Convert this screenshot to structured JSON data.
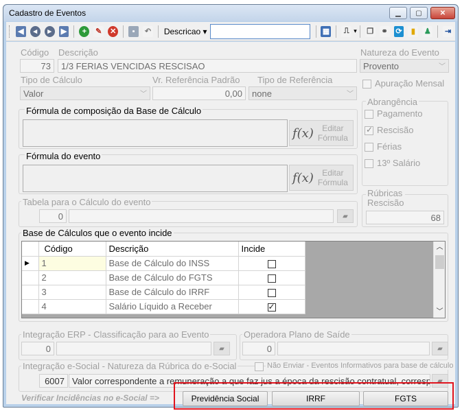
{
  "window": {
    "title": "Cadastro de Eventos",
    "minimize": "▁",
    "maximize": "▢",
    "close": "✕"
  },
  "toolbar": {
    "search_mode_label": "Descricao ▾",
    "search_value": ""
  },
  "form": {
    "codigo_label": "Código",
    "codigo_value": "73",
    "descricao_label": "Descrição",
    "descricao_value": "1/3 FERIAS VENCIDAS RESCISAO",
    "natureza_label": "Natureza do Evento",
    "natureza_value": "Provento",
    "tipo_calculo_label": "Tipo de Cálculo",
    "tipo_calculo_value": "Valor",
    "vr_referencia_label": "Vr. Referência Padrão",
    "vr_referencia_value": "0,00",
    "tipo_referencia_label": "Tipo de Referência",
    "tipo_referencia_value": "none",
    "apuracao_mensal_label": "Apuração Mensal",
    "formula_base_label": "Fórmula de composição da Base de Cálculo",
    "formula_evento_label": "Fórmula do evento",
    "editar_formula_label_1": "Editar",
    "editar_formula_label_2": "Fórmula",
    "fx_label": "f(x)",
    "abrangencia_label": "Abrangência",
    "abrangencia_items": [
      {
        "label": "Pagamento",
        "checked": false
      },
      {
        "label": "Rescisão",
        "checked": true
      },
      {
        "label": "Férias",
        "checked": false
      },
      {
        "label": "13º Salário",
        "checked": false
      }
    ],
    "tabela_calculo_label": "Tabela para o Cálculo do evento",
    "tabela_calculo_value": "0",
    "rubricas_label_1": "Rúbricas",
    "rubricas_label_2": "Rescisão",
    "rubricas_value": "68"
  },
  "base_calculos": {
    "title": "Base de Cálculos que o evento incide",
    "headers": [
      "Código",
      "Descrição",
      "Incide"
    ],
    "rows": [
      {
        "codigo": "1",
        "descricao": "Base de Cálculo do INSS",
        "incide": false
      },
      {
        "codigo": "2",
        "descricao": "Base de Cálculo do FGTS",
        "incide": false
      },
      {
        "codigo": "3",
        "descricao": "Base de Cálculo do IRRF",
        "incide": false
      },
      {
        "codigo": "4",
        "descricao": "Salário Líquido a Receber",
        "incide": true
      }
    ]
  },
  "integracao_erp": {
    "label": "Integração ERP - Classificação para ao Evento",
    "value": "0"
  },
  "operadora": {
    "label": "Operadora Plano de Saíde",
    "value": "0"
  },
  "esocial": {
    "label": "Integração e-Social - Natureza da Rúbrica do e-Social",
    "nao_enviar_label": "Não Enviar - Eventos Informativos para base de cálculo",
    "code": "6007",
    "description": "Valor correspondente a remuneração a que faz jus a época da rescisão contratual, corresp"
  },
  "footer": {
    "verificar_label": "Verificar Incidências no e-Social =>",
    "btn_previdencia": "Previdência Social",
    "btn_irrf": "IRRF",
    "btn_fgts": "FGTS"
  }
}
